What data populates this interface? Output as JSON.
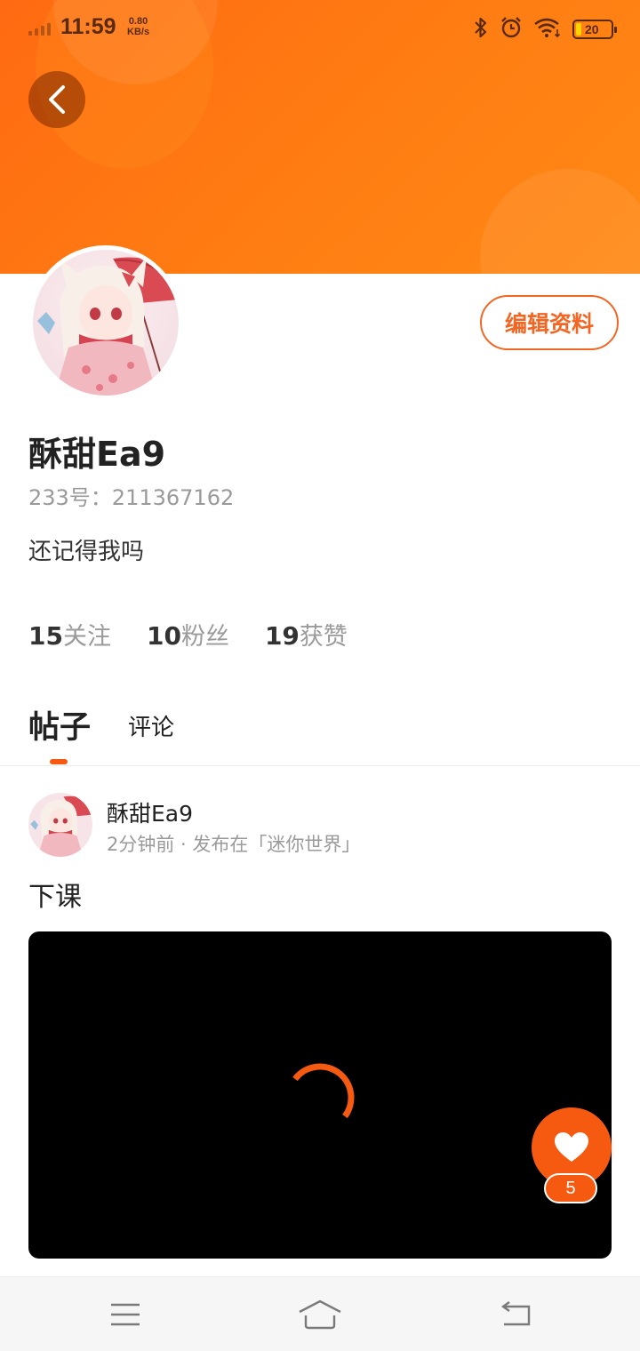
{
  "status_bar": {
    "time": "11:59",
    "speed_value": "0.80",
    "speed_unit": "KB/s",
    "battery_level": "20",
    "icons": [
      "signal-icon",
      "bluetooth-icon",
      "alarm-icon",
      "wifi-icon",
      "battery-icon"
    ]
  },
  "header": {
    "back_icon": "chevron-left-icon",
    "accent_color": "#ff7a12"
  },
  "profile": {
    "edit_label": "编辑资料",
    "username": "酥甜Ea9",
    "uid_text": "233号：211367162",
    "bio": "还记得我吗",
    "stats": [
      {
        "count": "15",
        "label": "关注"
      },
      {
        "count": "10",
        "label": "粉丝"
      },
      {
        "count": "19",
        "label": "获赞"
      }
    ]
  },
  "tabs": {
    "posts": "帖子",
    "comments": "评论",
    "active_color": "#f55a10"
  },
  "post": {
    "author": "酥甜Ea9",
    "meta": "2分钟前 · 发布在「迷你世界」",
    "title": "下课",
    "like_count": "5",
    "like_icon": "heart-icon",
    "loading_icon": "spinner-icon"
  },
  "nav_bar": {
    "icons": [
      "menu-icon",
      "home-icon",
      "back-icon"
    ],
    "background": "#f6f6f6"
  }
}
